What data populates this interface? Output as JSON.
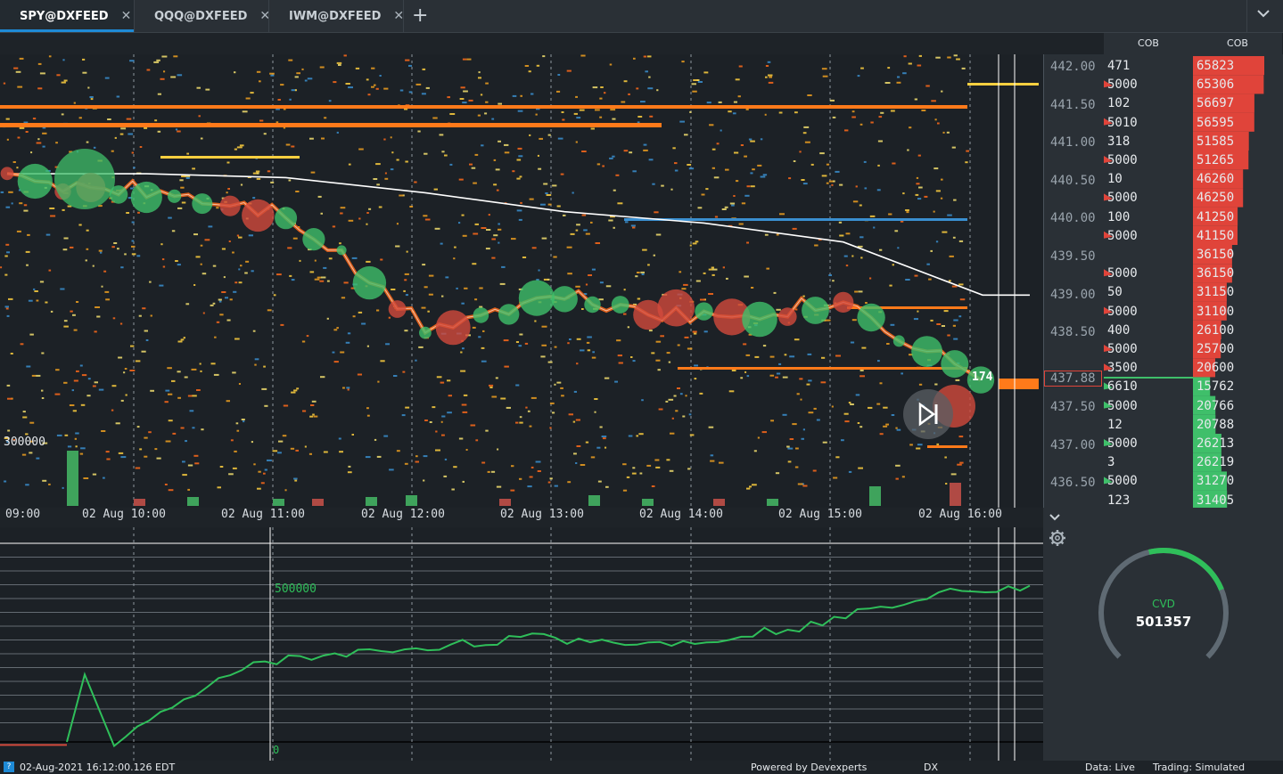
{
  "tabs": [
    {
      "label": "SPY@DXFEED",
      "active": true
    },
    {
      "label": "QQQ@DXFEED",
      "active": false
    },
    {
      "label": "IWM@DXFEED",
      "active": false
    }
  ],
  "icons": {
    "close": "close-icon",
    "add": "plus-icon",
    "expand": "chevron-down-icon",
    "settings": "gear-icon",
    "replay": "play-next-icon",
    "collapse": "chevron-down-icon"
  },
  "time_labels": [
    "09:00",
    "02 Aug 10:00",
    "02 Aug 11:00",
    "02 Aug 12:00",
    "02 Aug 13:00",
    "02 Aug 14:00",
    "02 Aug 15:00",
    "02 Aug 16:00"
  ],
  "price_labels": [
    "442.00",
    "441.50",
    "441.00",
    "440.50",
    "440.00",
    "439.50",
    "439.00",
    "438.50",
    "437.88",
    "437.50",
    "437.00",
    "436.50"
  ],
  "current_price": "437.88",
  "trade_size_label": "174",
  "volume_scale_label": "300000",
  "cvd_scale_labels": {
    "top": "500000",
    "zero": "0"
  },
  "cob": {
    "header1": "COB",
    "header2": "COB",
    "col1": [
      "471",
      "5000",
      "102",
      "5010",
      "318",
      "5000",
      "10",
      "5000",
      "100",
      "5000",
      "",
      "5000",
      "50",
      "5000",
      "400",
      "5000",
      "3500",
      "6610",
      "5000",
      "12",
      "5000",
      "3",
      "5000",
      "123"
    ],
    "col2": [
      "65823",
      "65306",
      "56697",
      "56595",
      "51585",
      "51265",
      "46260",
      "46250",
      "41250",
      "41150",
      "36150",
      "36150",
      "31150",
      "31100",
      "26100",
      "25700",
      "20600",
      "15762",
      "20766",
      "20788",
      "26213",
      "26219",
      "31270",
      "31405"
    ]
  },
  "gauge": {
    "label": "CVD",
    "value": "501357",
    "fraction": 0.55
  },
  "status": {
    "timestamp": "02-Aug-2021 16:12:00.126 EDT",
    "powered": "Powered by Devexperts",
    "dx": "DX",
    "data": "Data: Live",
    "trading": "Trading: Simulated"
  },
  "chart_data": {
    "type": "line",
    "x": [
      "09:00",
      "10:00",
      "11:00",
      "12:00",
      "13:00",
      "14:00",
      "15:00",
      "16:00"
    ],
    "price_range": [
      436.3,
      442.2
    ],
    "vwap": [
      440.6,
      440.6,
      440.55,
      440.35,
      440.1,
      439.95,
      439.7,
      439.0
    ],
    "price": [
      440.5,
      440.4,
      440.1,
      438.6,
      439.0,
      438.7,
      438.9,
      437.88
    ],
    "cvd_range": [
      -100000,
      700000
    ],
    "cvd": [
      0,
      260000,
      300000,
      340000,
      320000,
      380000,
      500000,
      510000
    ],
    "colors": {
      "buy": "#3fbf6a",
      "sell": "#d24a3c",
      "vwap": "#ffffff",
      "cvd": "#2fbf5a",
      "accent": "#1e8ad6"
    }
  }
}
